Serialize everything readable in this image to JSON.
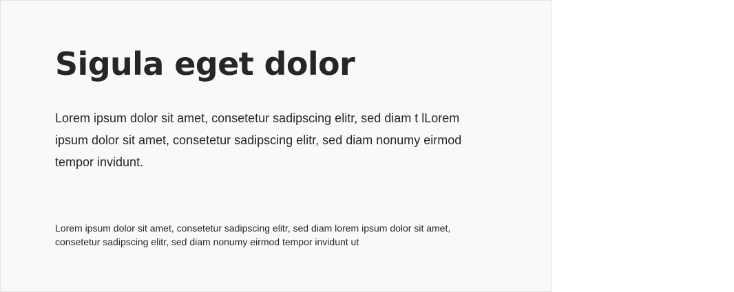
{
  "card": {
    "title": "Sigula eget dolor",
    "lead_text": "Lorem ipsum dolor sit amet, consetetur sadipscing elitr, sed diam t lLorem ipsum dolor sit amet, consetetur sadipscing elitr, sed diam nonumy eirmod tempor invidunt.",
    "small_text": "Lorem ipsum dolor sit amet, consetetur sadipscing elitr, sed diam lorem ipsum dolor sit amet, consetetur sadipscing elitr, sed diam nonumy eirmod tempor invidunt ut"
  },
  "colors": {
    "card_background": "#f9f9f9",
    "text": "#262626",
    "border": "#e3e3e3"
  }
}
